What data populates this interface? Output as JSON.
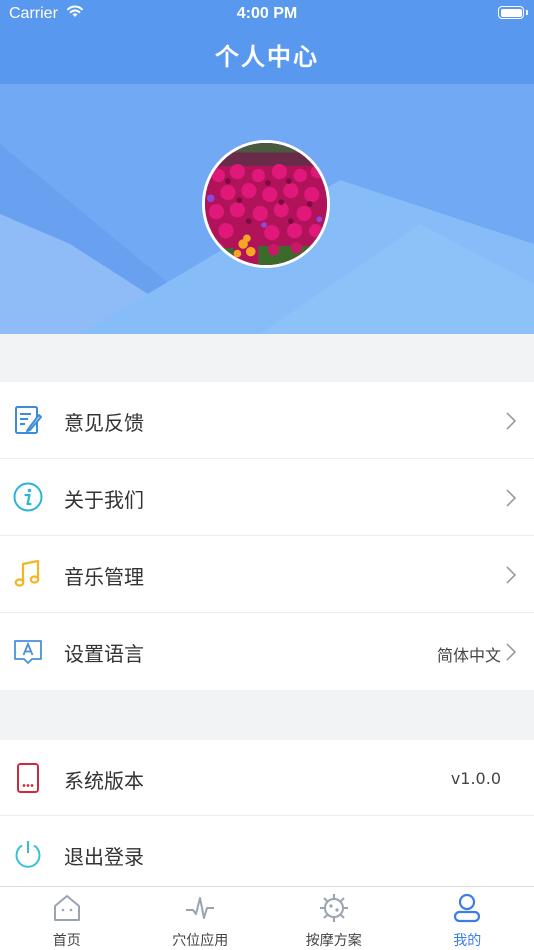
{
  "status_bar": {
    "carrier": "Carrier",
    "time": "4:00 PM"
  },
  "nav": {
    "title": "个人中心"
  },
  "colors": {
    "primary": "#5899ef",
    "tab_active": "#3b7ee8"
  },
  "menu": [
    {
      "label": "意见反馈",
      "value": "",
      "icon": "feedback-edit-icon"
    },
    {
      "label": "关于我们",
      "value": "",
      "icon": "info-icon"
    },
    {
      "label": "音乐管理",
      "value": "",
      "icon": "music-note-icon"
    },
    {
      "label": "设置语言",
      "value": "简体中文",
      "icon": "language-icon"
    }
  ],
  "system": [
    {
      "label": "系统版本",
      "value": "v1.0.0",
      "icon": "phone-icon"
    },
    {
      "label": "退出登录",
      "value": "",
      "icon": "power-icon"
    }
  ],
  "tabs": [
    {
      "label": "首页",
      "icon": "home-icon",
      "active": false
    },
    {
      "label": "穴位应用",
      "icon": "pulse-icon",
      "active": false
    },
    {
      "label": "按摩方案",
      "icon": "virus-icon",
      "active": false
    },
    {
      "label": "我的",
      "icon": "person-icon",
      "active": true
    }
  ]
}
